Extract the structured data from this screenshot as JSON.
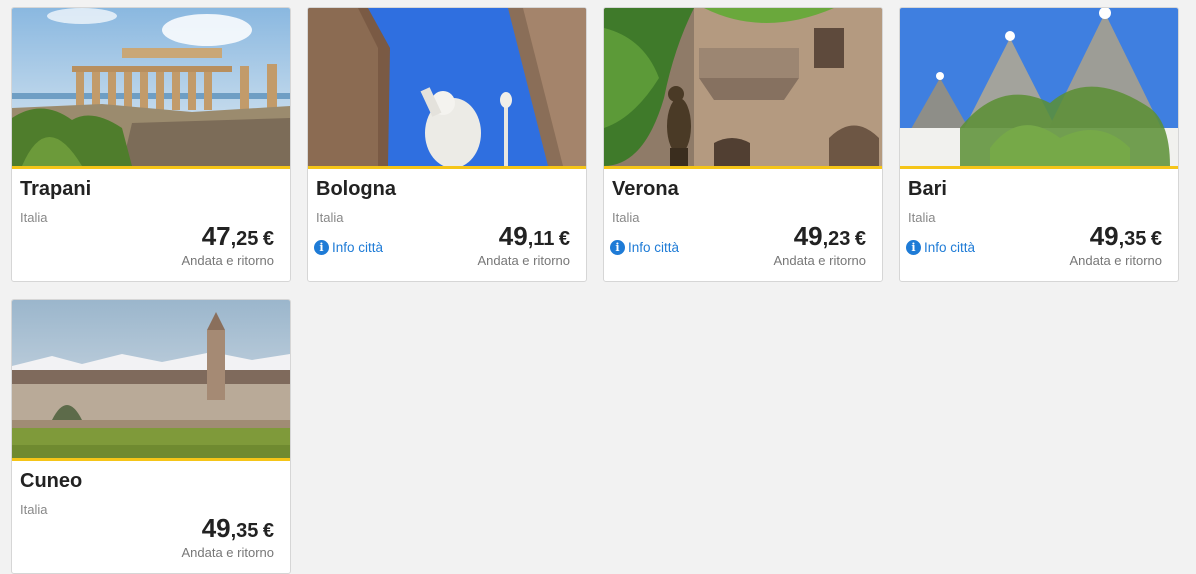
{
  "cards": [
    {
      "city": "Trapani",
      "country": "Italia",
      "info": "",
      "price_int": "47",
      "price_dec": ",25",
      "currency": "€",
      "trip": "Andata e ritorno",
      "image": "trapani-temple-photo"
    },
    {
      "city": "Bologna",
      "country": "Italia",
      "info": "Info città",
      "price_int": "49",
      "price_dec": ",11",
      "currency": "€",
      "trip": "Andata e ritorno",
      "image": "bologna-towers-statue-photo"
    },
    {
      "city": "Verona",
      "country": "Italia",
      "info": "Info città",
      "price_int": "49",
      "price_dec": ",23",
      "currency": "€",
      "trip": "Andata e ritorno",
      "image": "verona-balcony-statue-photo"
    },
    {
      "city": "Bari",
      "country": "Italia",
      "info": "Info città",
      "price_int": "49",
      "price_dec": ",35",
      "currency": "€",
      "trip": "Andata e ritorno",
      "image": "bari-trulli-photo"
    },
    {
      "city": "Cuneo",
      "country": "Italia",
      "info": "",
      "price_int": "49",
      "price_dec": ",35",
      "currency": "€",
      "trip": "Andata e ritorno",
      "image": "cuneo-abbey-photo"
    }
  ],
  "info_icon": "info-circle-icon",
  "colors": {
    "accent": "#f5c518",
    "link": "#1e7bd6",
    "background": "#f2f2f2"
  }
}
